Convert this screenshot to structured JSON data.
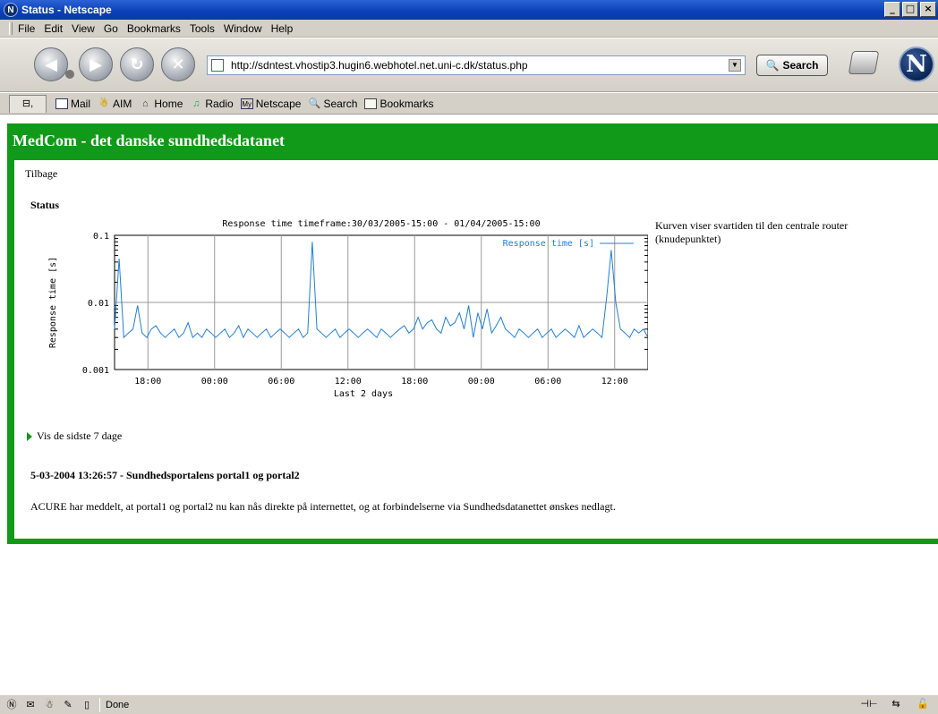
{
  "window": {
    "title": "Status - Netscape",
    "controls": {
      "minimize": "_",
      "maximize": "□",
      "close": "×"
    }
  },
  "menubar": {
    "items": [
      "File",
      "Edit",
      "View",
      "Go",
      "Bookmarks",
      "Tools",
      "Window",
      "Help"
    ]
  },
  "navbar": {
    "url": "http://sdntest.vhostip3.hugin6.webhotel.net.uni-c.dk/status.php",
    "search_label": "Search",
    "icons": [
      "back-icon",
      "forward-icon",
      "reload-icon",
      "stop-icon",
      "print-icon",
      "netscape-logo"
    ]
  },
  "personal_toolbar": {
    "items": [
      {
        "label": "Mail",
        "icon": "mail-icon"
      },
      {
        "label": "AIM",
        "icon": "aim-icon"
      },
      {
        "label": "Home",
        "icon": "home-icon"
      },
      {
        "label": "Radio",
        "icon": "radio-icon"
      },
      {
        "label": "Netscape",
        "icon": "my-netscape-icon"
      },
      {
        "label": "Search",
        "icon": "search-icon"
      },
      {
        "label": "Bookmarks",
        "icon": "bookmarks-icon"
      }
    ]
  },
  "page": {
    "site_title": "MedCom - det danske sundhedsdatanet",
    "back_link": "Tilbage",
    "status_heading": "Status",
    "chart_description": "Kurven viser svartiden til den centrale router (knudepunktet)",
    "vis_link": "Vis de sidste 7 dage",
    "news_title": "5-03-2004 13:26:57 - Sundhedsportalens portal1 og portal2",
    "news_body": "ACURE har meddelt, at portal1 og portal2 nu kan nås direkte på internettet, og at forbindelserne via Sundhedsdatanettet ønskes nedlagt.",
    "accent_color": "#119a19"
  },
  "chart_data": {
    "type": "line",
    "title": "Response time timeframe:30/03/2005-15:00 - 01/04/2005-15:00",
    "xlabel": "Last 2 days",
    "ylabel": "Response time [s]",
    "yscale": "log",
    "ylim": [
      0.001,
      0.1
    ],
    "y_ticks": [
      "0.1",
      "0.01",
      "0.001"
    ],
    "x_ticks": [
      "18:00",
      "00:00",
      "06:00",
      "12:00",
      "18:00",
      "00:00",
      "06:00",
      "12:00"
    ],
    "legend_position": "top-right",
    "grid": true,
    "line_color": "#1e7fe0",
    "series": [
      {
        "name": "Response time [s]",
        "x_start": "30/03/2005 15:00",
        "x_step_hours": 0.5,
        "values": [
          0.004,
          0.045,
          0.003,
          0.0035,
          0.004,
          0.009,
          0.0035,
          0.003,
          0.004,
          0.0045,
          0.0035,
          0.003,
          0.0035,
          0.004,
          0.003,
          0.0035,
          0.005,
          0.003,
          0.0035,
          0.003,
          0.004,
          0.0035,
          0.003,
          0.0035,
          0.004,
          0.003,
          0.0035,
          0.0045,
          0.003,
          0.004,
          0.0035,
          0.003,
          0.0035,
          0.004,
          0.003,
          0.0035,
          0.004,
          0.0035,
          0.003,
          0.0035,
          0.004,
          0.003,
          0.0035,
          0.08,
          0.004,
          0.0035,
          0.003,
          0.0035,
          0.004,
          0.003,
          0.0035,
          0.004,
          0.0035,
          0.003,
          0.0035,
          0.004,
          0.0035,
          0.003,
          0.004,
          0.0035,
          0.003,
          0.0035,
          0.004,
          0.0045,
          0.0035,
          0.004,
          0.006,
          0.004,
          0.005,
          0.0055,
          0.004,
          0.0035,
          0.006,
          0.0045,
          0.005,
          0.007,
          0.004,
          0.009,
          0.003,
          0.007,
          0.004,
          0.008,
          0.0035,
          0.0045,
          0.006,
          0.004,
          0.0035,
          0.003,
          0.004,
          0.0035,
          0.003,
          0.0035,
          0.004,
          0.003,
          0.0035,
          0.004,
          0.003,
          0.0035,
          0.004,
          0.0035,
          0.003,
          0.0045,
          0.003,
          0.0035,
          0.004,
          0.0035,
          0.003,
          0.012,
          0.06,
          0.01,
          0.004,
          0.0035,
          0.003,
          0.004,
          0.0035,
          0.004,
          0.003
        ]
      }
    ]
  }
}
